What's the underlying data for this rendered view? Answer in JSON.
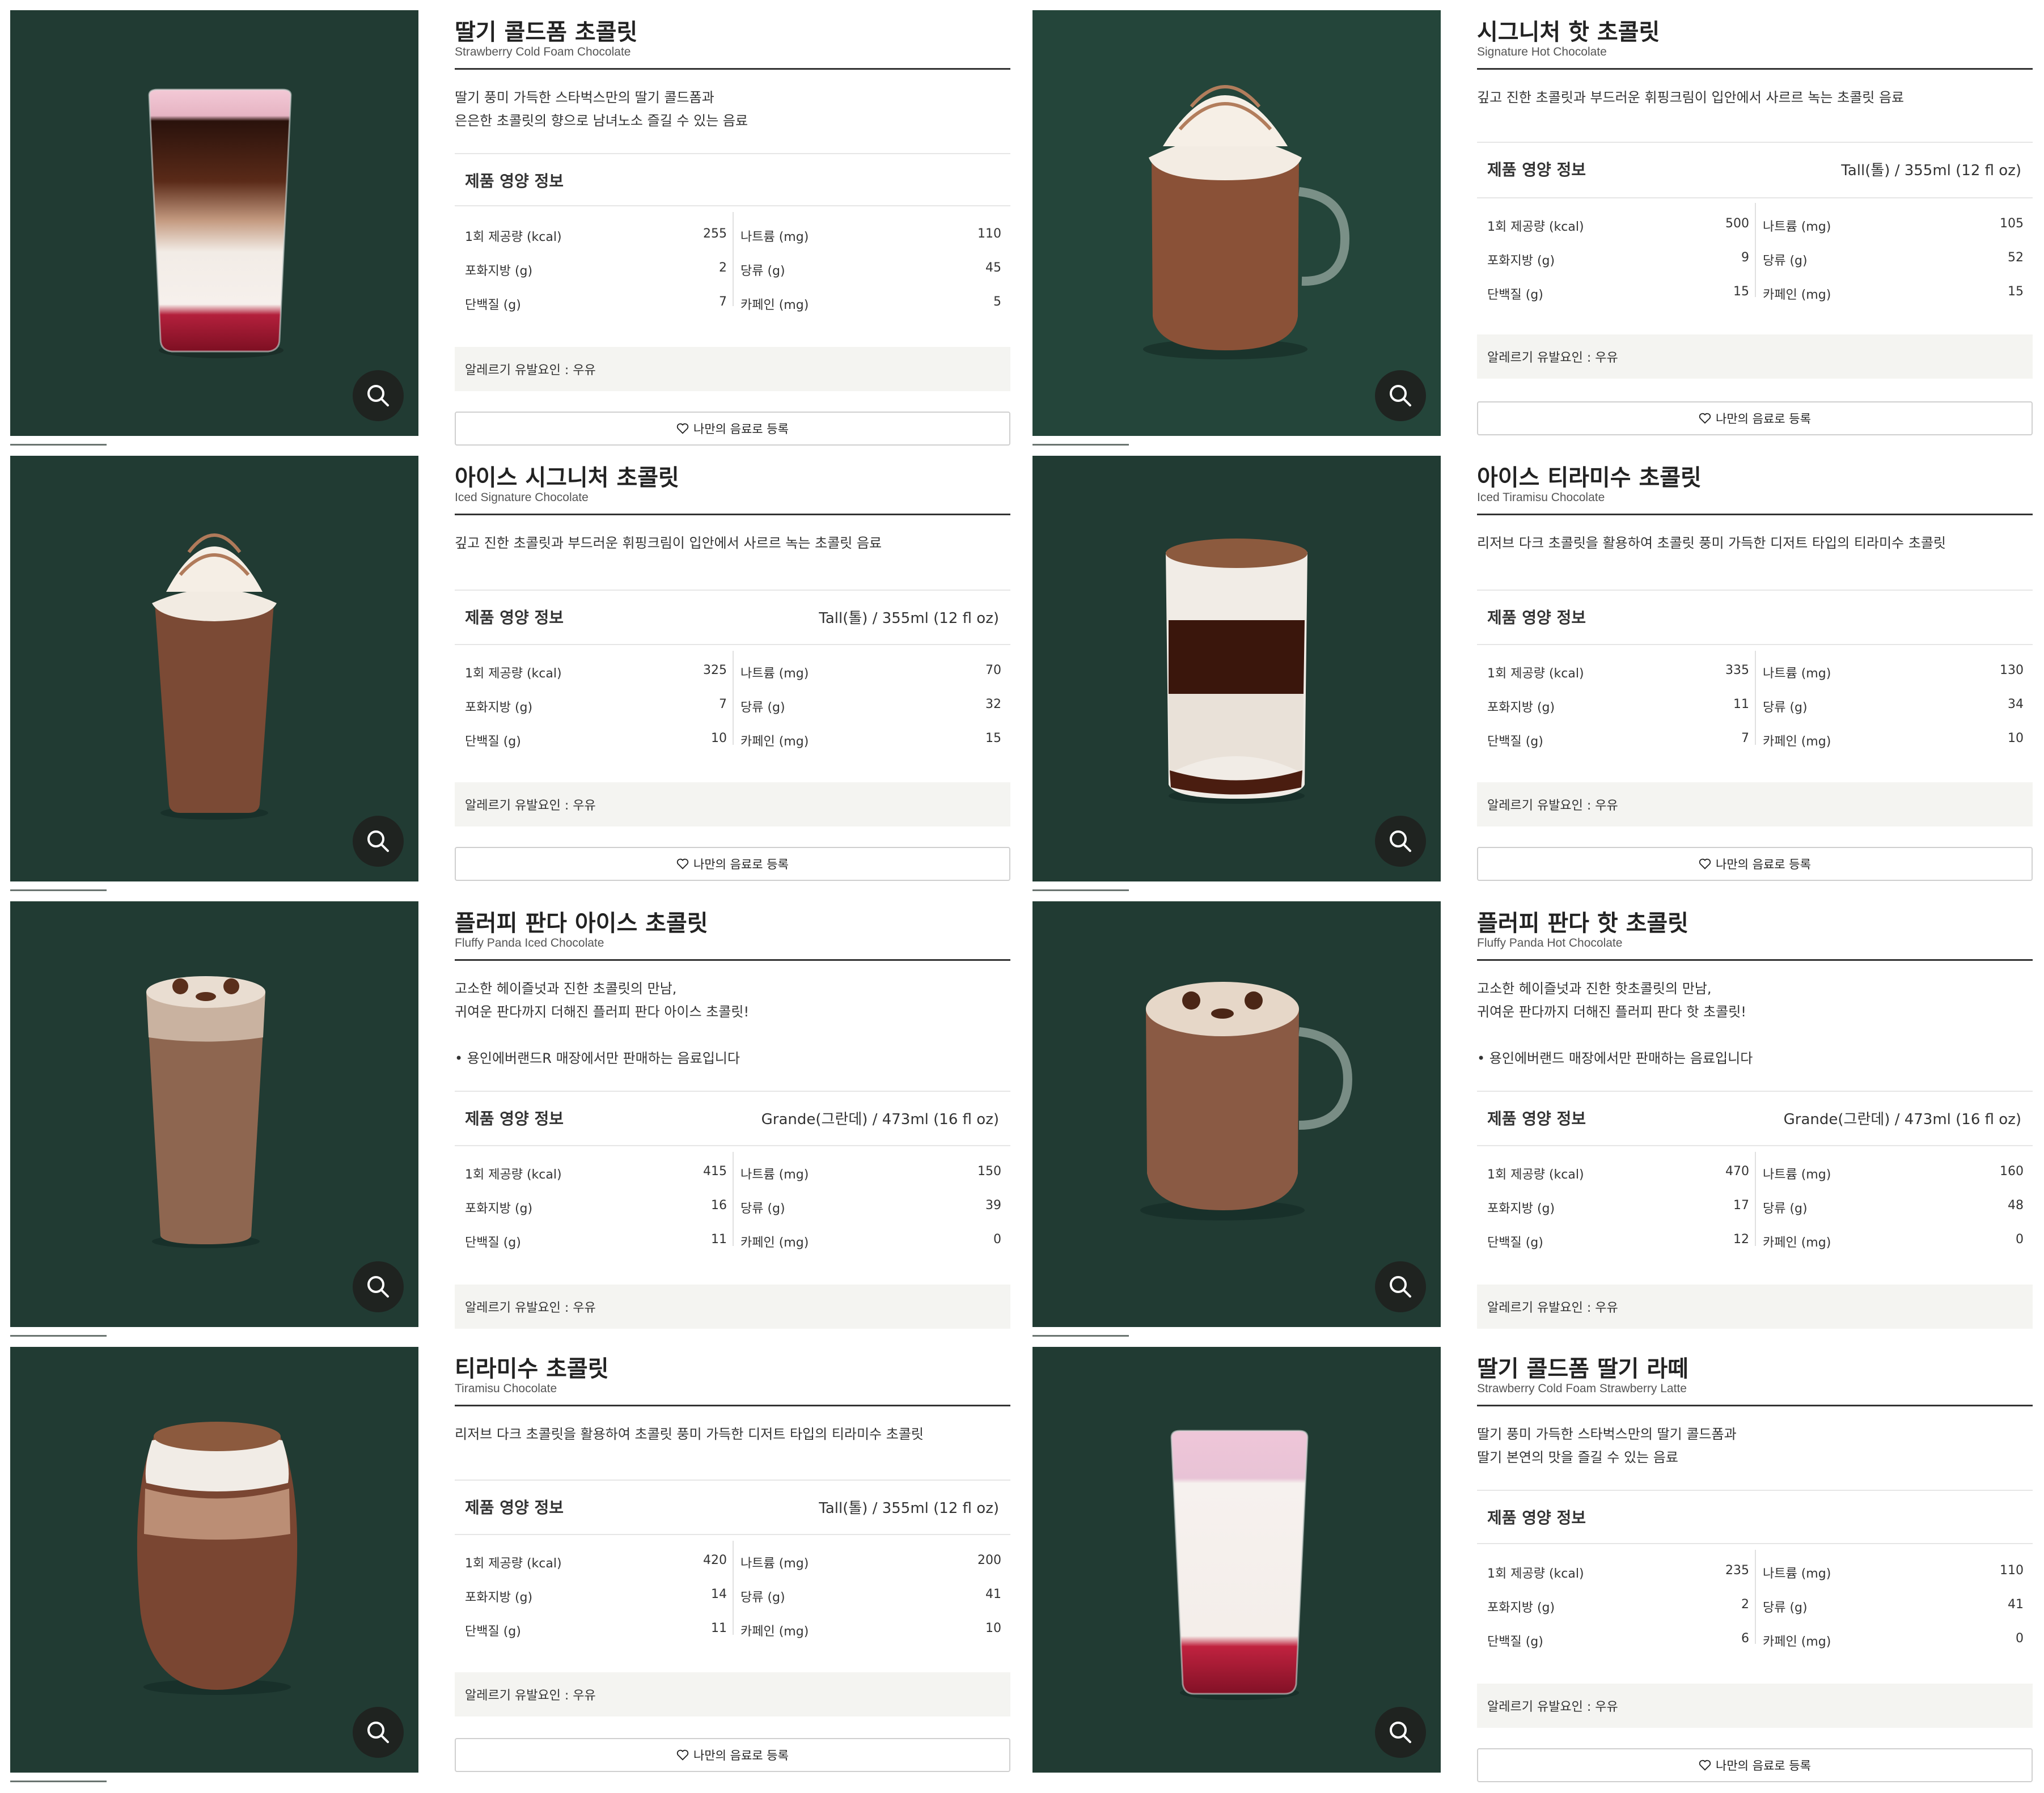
{
  "colors": {
    "panel_bg": "#213b33",
    "allergy_bg": "#f4f4f1"
  },
  "labels": {
    "nutrition_title": "제품 영양 정보",
    "kcal": "1회 제공량 (kcal)",
    "sat_fat": "포화지방 (g)",
    "protein": "단백질 (g)",
    "sodium": "나트륨 (mg)",
    "sugar": "당류 (g)",
    "caffeine": "카페인 (mg)",
    "allergy": "알레르기 유발요인 : 우유",
    "my_drink": "나만의 음료로 등록"
  },
  "products": [
    {
      "name": "딸기 콜드폼 초콜릿",
      "name_en": "Strawberry Cold Foam Chocolate",
      "desc": "딸기 풍미 가득한 스타벅스만의 딸기 콜드폼과\n은은한 초콜릿의 향으로 남녀노소 즐길 수 있는 음료",
      "size": "",
      "kcal": "255",
      "sat_fat": "2",
      "protein": "7",
      "sodium": "110",
      "sugar": "45",
      "caffeine": "5"
    },
    {
      "name": "시그니처 핫 초콜릿",
      "name_en": "Signature Hot Chocolate",
      "desc": "깊고 진한 초콜릿과 부드러운 휘핑크림이 입안에서 사르르 녹는 초콜릿 음료",
      "size": "Tall(톨) / 355ml (12 fl oz)",
      "kcal": "500",
      "sat_fat": "9",
      "protein": "15",
      "sodium": "105",
      "sugar": "52",
      "caffeine": "15"
    },
    {
      "name": "아이스 시그니처 초콜릿",
      "name_en": "Iced Signature Chocolate",
      "desc": "깊고 진한 초콜릿과 부드러운 휘핑크림이 입안에서 사르르 녹는 초콜릿 음료",
      "size": "Tall(톨) / 355ml (12 fl oz)",
      "kcal": "325",
      "sat_fat": "7",
      "protein": "10",
      "sodium": "70",
      "sugar": "32",
      "caffeine": "15"
    },
    {
      "name": "아이스 티라미수 초콜릿",
      "name_en": "Iced Tiramisu Chocolate",
      "desc": "리저브 다크 초콜릿을 활용하여 초콜릿 풍미 가득한 디저트 타입의 티라미수 초콜릿",
      "size": "",
      "kcal": "335",
      "sat_fat": "11",
      "protein": "7",
      "sodium": "130",
      "sugar": "34",
      "caffeine": "10"
    },
    {
      "name": "플러피 판다 아이스 초콜릿",
      "name_en": "Fluffy Panda Iced Chocolate",
      "desc": "고소한 헤이즐넛과 진한 초콜릿의 만남,\n귀여운 판다까지 더해진 플러피 판다 아이스 초콜릿!\n\n• 용인에버랜드R 매장에서만 판매하는 음료입니다",
      "size": "Grande(그란데) / 473ml (16 fl oz)",
      "kcal": "415",
      "sat_fat": "16",
      "protein": "11",
      "sodium": "150",
      "sugar": "39",
      "caffeine": "0"
    },
    {
      "name": "플러피 판다 핫 초콜릿",
      "name_en": "Fluffy Panda Hot Chocolate",
      "desc": "고소한 헤이즐넛과 진한 핫초콜릿의 만남,\n귀여운 판다까지 더해진 플러피 판다 핫 초콜릿!\n\n• 용인에버랜드 매장에서만 판매하는 음료입니다",
      "size": "Grande(그란데) / 473ml (16 fl oz)",
      "kcal": "470",
      "sat_fat": "17",
      "protein": "12",
      "sodium": "160",
      "sugar": "48",
      "caffeine": "0"
    },
    {
      "name": "티라미수 초콜릿",
      "name_en": "Tiramisu Chocolate",
      "desc": "리저브 다크 초콜릿을 활용하여 초콜릿 풍미 가득한 디저트 타입의 티라미수 초콜릿",
      "size": "Tall(톨) / 355ml (12 fl oz)",
      "kcal": "420",
      "sat_fat": "14",
      "protein": "11",
      "sodium": "200",
      "sugar": "41",
      "caffeine": "10"
    },
    {
      "name": "딸기 콜드폼 딸기 라떼",
      "name_en": "Strawberry Cold Foam Strawberry Latte",
      "desc": "딸기 풍미 가득한 스타벅스만의 딸기 콜드폼과\n딸기 본연의 맛을 즐길 수 있는 음료",
      "size": "",
      "kcal": "235",
      "sat_fat": "2",
      "protein": "6",
      "sodium": "110",
      "sugar": "41",
      "caffeine": "0"
    }
  ]
}
